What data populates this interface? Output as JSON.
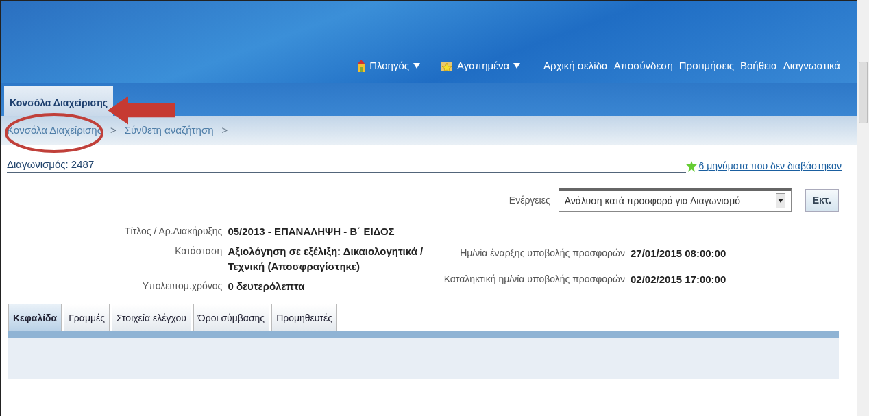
{
  "global_nav": {
    "menus": [
      {
        "label": "Πλοηγός"
      },
      {
        "label": "Αγαπημένα"
      }
    ],
    "links": [
      "Αρχική σελίδα",
      "Αποσύνδεση",
      "Προτιμήσεις",
      "Βοήθεια",
      "Διαγνωστικά"
    ]
  },
  "app_tabs": [
    {
      "label": "Κονσόλα Διαχείρισης",
      "selected": true
    }
  ],
  "breadcrumbs": [
    {
      "label": "Κονσόλα Διαχείρισης",
      "separator": ">"
    },
    {
      "label": "Σύνθετη αναζήτηση",
      "separator": ">"
    }
  ],
  "page_title": "Διαγωνισμός: 2487",
  "messages_link": "6 μηνύματα που δεν διαβάστηκαν",
  "actions": {
    "label": "Ενέργειες",
    "value": "Ανάλυση κατά προσφορά για Διαγωνισμό",
    "button": "Εκτ."
  },
  "details_left": [
    {
      "label": "Τίτλος / Αρ.Διακήρυξης",
      "value": "05/2013 - ΕΠΑΝΑΛΗΨΗ - Β΄ ΕΙΔΟΣ"
    },
    {
      "label": "Κατάσταση",
      "value": "Αξιολόγηση σε εξέλιξη: Δικαιολογητικά / Τεχνική (Αποσφραγίστηκε)"
    },
    {
      "label": "Υπολειπομ.χρόνος",
      "value": "0 δευτερόλεπτα"
    }
  ],
  "details_right": [
    {
      "label": "Ημ/νία έναρξης υποβολής προσφορών",
      "value": "27/01/2015 08:00:00"
    },
    {
      "label": "Καταληκτική ημ/νία υποβολής προσφορών",
      "value": "02/02/2015 17:00:00"
    }
  ],
  "tabs": [
    {
      "label": "Κεφαλίδα",
      "selected": true
    },
    {
      "label": "Γραμμές",
      "selected": false
    },
    {
      "label": "Στοιχεία ελέγχου",
      "selected": false
    },
    {
      "label": "Όροι σύμβασης",
      "selected": false
    },
    {
      "label": "Προμηθευτές",
      "selected": false
    }
  ]
}
